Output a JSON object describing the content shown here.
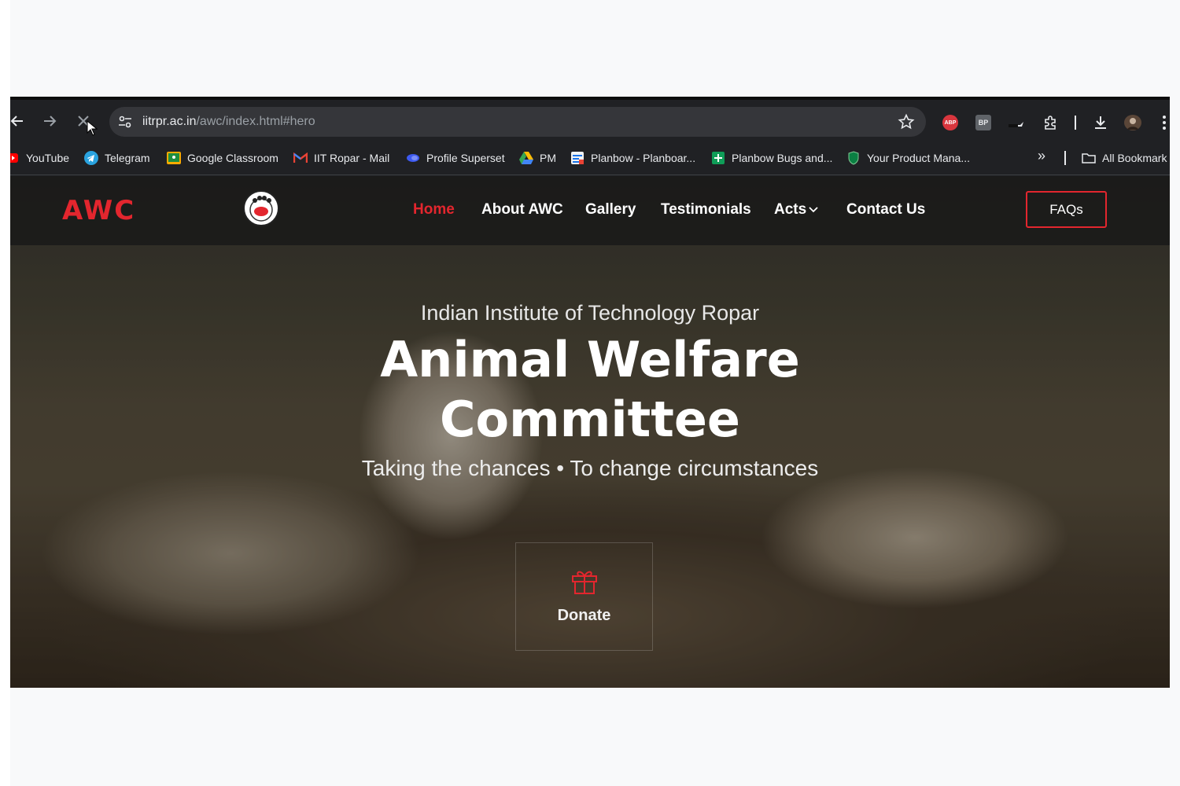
{
  "browser": {
    "url_host": "iitrpr.ac.in",
    "url_path": "/awc/index.html#hero",
    "bookmarks": [
      {
        "label": "YouTube",
        "icon": "youtube-icon"
      },
      {
        "label": "Telegram",
        "icon": "telegram-icon"
      },
      {
        "label": "Google Classroom",
        "icon": "google-classroom-icon"
      },
      {
        "label": "IIT Ropar - Mail",
        "icon": "gmail-icon"
      },
      {
        "label": "Profile Superset",
        "icon": "superset-icon"
      },
      {
        "label": "PM",
        "icon": "google-drive-icon"
      },
      {
        "label": "Planbow - Planboar...",
        "icon": "planbow-icon"
      },
      {
        "label": "Planbow Bugs and...",
        "icon": "sheets-icon"
      },
      {
        "label": "Your Product Mana...",
        "icon": "shield-icon"
      }
    ],
    "all_bookmarks_label": "All Bookmark",
    "extensions": {
      "abp": "ABP",
      "bp": "BP"
    }
  },
  "site": {
    "brand": "AWC",
    "nav": [
      {
        "label": "Home",
        "active": true
      },
      {
        "label": "About AWC"
      },
      {
        "label": "Gallery"
      },
      {
        "label": "Testimonials"
      },
      {
        "label": "Acts"
      },
      {
        "label": "Contact Us"
      }
    ],
    "faq_label": "FAQs",
    "accent": "#e3262e"
  },
  "hero": {
    "subtitle": "Indian Institute of Technology Ropar",
    "title_line1": "Animal Welfare",
    "title_line2": "Committee",
    "tagline": "Taking the chances • To change circumstances",
    "donate_label": "Donate"
  }
}
